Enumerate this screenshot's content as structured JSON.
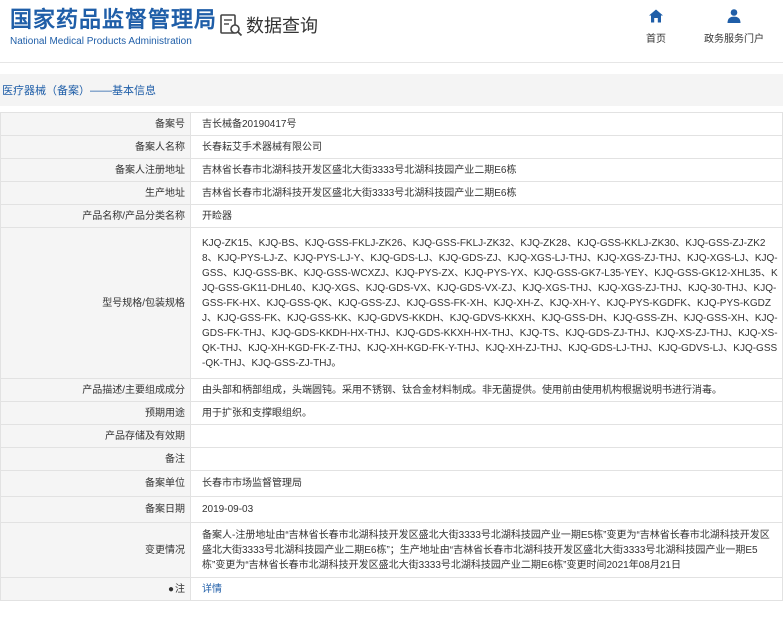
{
  "header": {
    "brand_cn": "国家药品监督管理局",
    "brand_en": "National Medical Products Administration",
    "query_title": "数据查询",
    "nav": [
      {
        "label": "首页",
        "icon": "home-icon"
      },
      {
        "label": "政务服务门户",
        "icon": "user-icon"
      }
    ]
  },
  "breadcrumb": "医疗器械（备案）——基本信息",
  "colors": {
    "brand": "#1f5ea8",
    "label_bg": "#f5f5f5",
    "border": "#e2e2e2"
  },
  "fields": {
    "record_no": {
      "label": "备案号",
      "value": "吉长械备20190417号"
    },
    "filer_name": {
      "label": "备案人名称",
      "value": "长春耘艾手术器械有限公司"
    },
    "filer_address": {
      "label": "备案人注册地址",
      "value": "吉林省长春市北湖科技开发区盛北大街3333号北湖科技园产业二期E6栋"
    },
    "production_address": {
      "label": "生产地址",
      "value": "吉林省长春市北湖科技开发区盛北大街3333号北湖科技园产业二期E6栋"
    },
    "product_name": {
      "label": "产品名称/产品分类名称",
      "value": "开睑器"
    },
    "model_spec": {
      "label": "型号规格/包装规格",
      "value": "KJQ-ZK15、KJQ-BS、KJQ-GSS-FKLJ-ZK26、KJQ-GSS-FKLJ-ZK32、KJQ-ZK28、KJQ-GSS-KKLJ-ZK30、KJQ-GSS-ZJ-ZK28、KJQ-PYS-LJ-Z、KJQ-PYS-LJ-Y、KJQ-GDS-LJ、KJQ-GDS-ZJ、KJQ-XGS-LJ-THJ、KJQ-XGS-ZJ-THJ、KJQ-XGS-LJ、KJQ-GSS、KJQ-GSS-BK、KJQ-GSS-WCXZJ、KJQ-PYS-ZX、KJQ-PYS-YX、KJQ-GSS-GK7-L35-YEY、KJQ-GSS-GK12-XHL35、KJQ-GSS-GK11-DHL40、KJQ-XGS、KJQ-GDS-VX、KJQ-GDS-VX-ZJ、KJQ-XGS-THJ、KJQ-XGS-ZJ-THJ、KJQ-30-THJ、KJQ-GSS-FK-HX、KJQ-GSS-QK、KJQ-GSS-ZJ、KJQ-GSS-FK-XH、KJQ-XH-Z、KJQ-XH-Y、KJQ-PYS-KGDFK、KJQ-PYS-KGDZJ、KJQ-GSS-FK、KJQ-GSS-KK、KJQ-GDVS-KKDH、KJQ-GDVS-KKXH、KJQ-GSS-DH、KJQ-GSS-ZH、KJQ-GSS-XH、KJQ-GDS-FK-THJ、KJQ-GDS-KKDH-HX-THJ、KJQ-GDS-KKXH-HX-THJ、KJQ-TS、KJQ-GDS-ZJ-THJ、KJQ-XS-ZJ-THJ、KJQ-XS-QK-THJ、KJQ-XH-KGD-FK-Z-THJ、KJQ-XH-KGD-FK-Y-THJ、KJQ-XH-ZJ-THJ、KJQ-GDS-LJ-THJ、KJQ-GDVS-LJ、KJQ-GSS-QK-THJ、KJQ-GSS-ZJ-THJ。"
    },
    "description": {
      "label": "产品描述/主要组成成分",
      "value": "由头部和柄部组成，头端圆钝。采用不锈钢、钛合金材料制成。非无菌提供。使用前由使用机构根据说明书进行消毒。"
    },
    "intended_use": {
      "label": "预期用途",
      "value": "用于扩张和支撑眼组织。"
    },
    "storage": {
      "label": "产品存储及有效期",
      "value": ""
    },
    "remark": {
      "label": "备注",
      "value": ""
    },
    "filing_unit": {
      "label": "备案单位",
      "value": "长春市市场监督管理局"
    },
    "filing_date": {
      "label": "备案日期",
      "value": "2019-09-03"
    },
    "changes": {
      "label": "变更情况",
      "value": "备案人-注册地址由“吉林省长春市北湖科技开发区盛北大街3333号北湖科技园产业一期E5栋”变更为“吉林省长春市北湖科技开发区盛北大街3333号北湖科技园产业二期E6栋”；生产地址由“吉林省长春市北湖科技开发区盛北大街3333号北湖科技园产业一期E5栋”变更为“吉林省长春市北湖科技开发区盛北大街3333号北湖科技园产业二期E6栋”变更时间2021年08月21日"
    },
    "note": {
      "label": "注",
      "link": "详情",
      "icon": "bullet-icon"
    }
  }
}
